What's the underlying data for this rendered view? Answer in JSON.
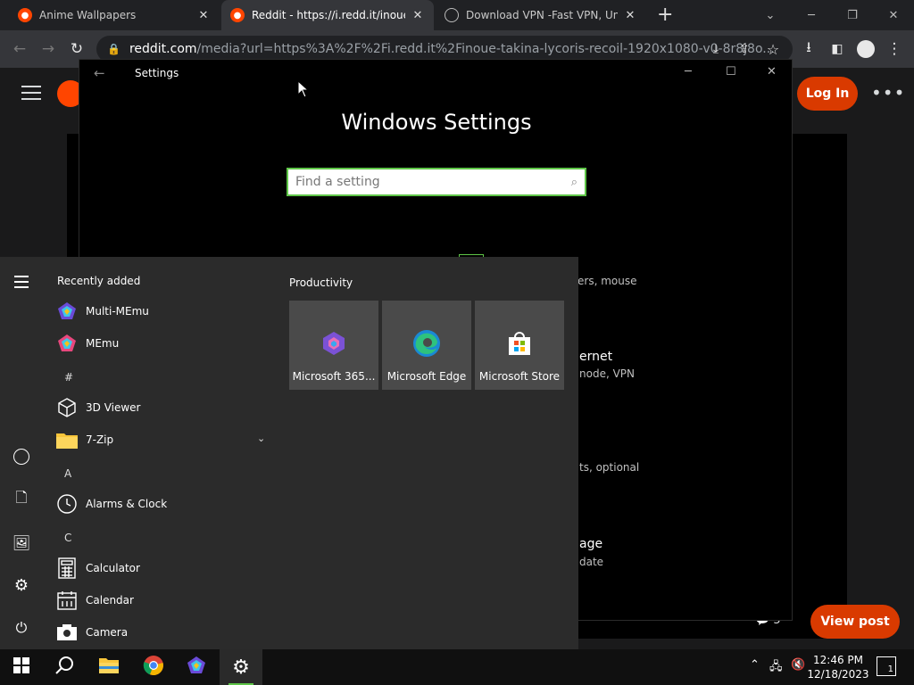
{
  "browser": {
    "tabs": [
      {
        "title": "Anime Wallpapers",
        "close": "✕"
      },
      {
        "title": "Reddit - https://i.redd.it/inoue-ta",
        "close": "✕"
      },
      {
        "title": "Download VPN -Fast VPN, Unlim",
        "close": "✕"
      }
    ],
    "new_tab": "+",
    "address": {
      "host": "reddit.com",
      "path": "/media?url=https%3A%2F%2Fi.redd.it%2Finoue-takina-lycoris-recoil-1920x1080-v0-8r8j8o..."
    }
  },
  "reddit": {
    "login_label": "Log In",
    "view_post_label": "View post",
    "comment_count": "5"
  },
  "settings": {
    "window_title": "Settings",
    "heading": "Windows Settings",
    "search_placeholder": "Find a setting",
    "fragments": {
      "devices": "ers, mouse",
      "network_title": "ernet",
      "network_sub": "node, VPN",
      "apps_sub": "ts, optional",
      "language_title": "age",
      "language_sub": "date"
    }
  },
  "start_menu": {
    "recently_added_label": "Recently added",
    "productivity_label": "Productivity",
    "apps": [
      {
        "name": "Multi-MEmu"
      },
      {
        "name": "MEmu"
      },
      {
        "letter": "#"
      },
      {
        "name": "3D Viewer"
      },
      {
        "name": "7-Zip"
      },
      {
        "letter": "A"
      },
      {
        "name": "Alarms & Clock"
      },
      {
        "letter": "C"
      },
      {
        "name": "Calculator"
      },
      {
        "name": "Calendar"
      },
      {
        "name": "Camera"
      }
    ],
    "tiles": [
      {
        "label": "Microsoft 365..."
      },
      {
        "label": "Microsoft Edge"
      },
      {
        "label": "Microsoft Store"
      }
    ]
  },
  "taskbar": {
    "time": "12:46 PM",
    "date": "12/18/2023",
    "notification_count": "1"
  },
  "colors": {
    "accent_green": "#5ec547",
    "reddit_orange": "#d93a00"
  }
}
